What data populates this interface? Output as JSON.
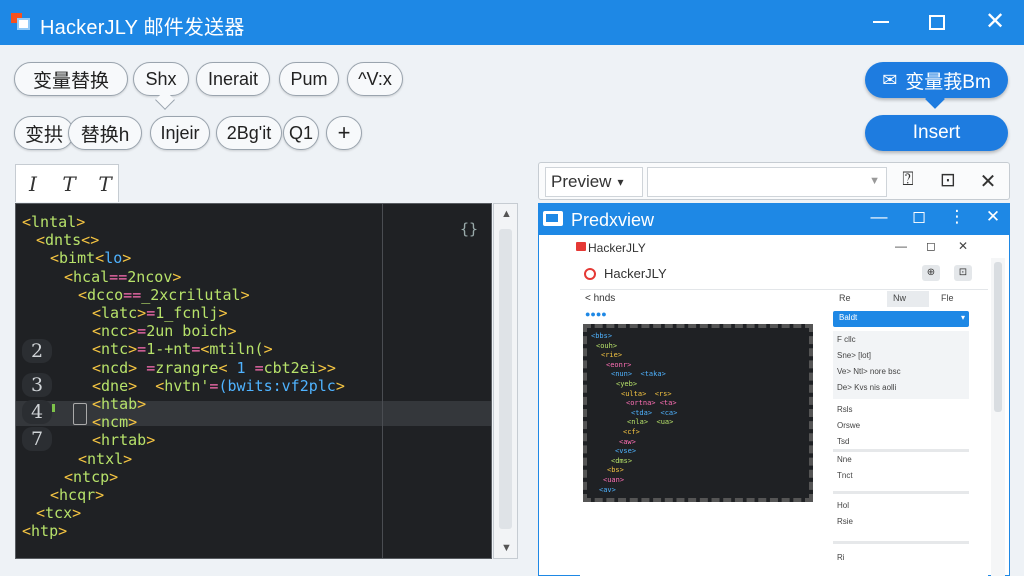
{
  "window": {
    "title": "HackerJLY 邮件发送器",
    "controls": {
      "minimize": "",
      "maximize": "",
      "close": "✕"
    }
  },
  "toolbar": {
    "row1": [
      "变量替换",
      "Shx",
      "Inerait",
      "Pum",
      "^V:x"
    ],
    "row2": [
      "变拱",
      "替换h",
      "Injeir",
      "2Bg'it",
      "Q1",
      "+"
    ],
    "send_label": "变量莪Bm",
    "insert_label": "Insert"
  },
  "editor": {
    "format_buttons": [
      "I",
      "T",
      "T"
    ],
    "fold_marker": "{}",
    "gutter_numbers": [
      "2",
      "3",
      "4",
      "7"
    ],
    "lines": [
      {
        "indent": 0,
        "text": "<lntal>"
      },
      {
        "indent": 1,
        "text": "<dnts<>"
      },
      {
        "indent": 2,
        "text": "<bimt<lo>"
      },
      {
        "indent": 3,
        "text": "<hcal==2ncov>"
      },
      {
        "indent": 4,
        "text": "<dcco==_2xcrilutal>"
      },
      {
        "indent": 5,
        "text": "<latc>=1_fcnlj>"
      },
      {
        "indent": 5,
        "text": "<ncc>=2un boich>"
      },
      {
        "indent": 5,
        "text": "<ntc>=1-+nt=<mtiln(>"
      },
      {
        "indent": 5,
        "text": "<ncd> =zrangre< 1 =cbt2ei>>"
      },
      {
        "indent": 5,
        "text": "<dne>  <hvtn'=(bwits:vf2plc>"
      },
      {
        "indent": 5,
        "text": "<htab>"
      },
      {
        "indent": 5,
        "text": "<ncm>"
      },
      {
        "indent": 5,
        "text": "<hrtab>"
      },
      {
        "indent": 4,
        "text": "<ntxl>"
      },
      {
        "indent": 3,
        "text": "<ntcp>"
      },
      {
        "indent": 2,
        "text": "<hcqr>"
      },
      {
        "indent": 1,
        "text": "<tcx>"
      },
      {
        "indent": 0,
        "text": "<htp>"
      }
    ]
  },
  "preview": {
    "dropdown_label": "Preview",
    "window_title": "Predxview",
    "mini": {
      "title": "HackerJLY",
      "subtitle": "HackerJLY",
      "crumb": "< hnds",
      "dots": "●●●●",
      "tabs": [
        "Re",
        "Nw",
        "Fle"
      ],
      "selected": "Baldt",
      "panel_rows": [
        "F cllc",
        "Sne> [lot]",
        "Ve> Ntl> nore bsc",
        "De> Kvs nis aolli"
      ],
      "list_rows": [
        "Rsls",
        "Orswe",
        "Tsd",
        "Nne",
        "Tnct",
        "Hol",
        "Rsie",
        "Ri"
      ],
      "editor_lines": [
        "<bbs>",
        "<ouh>",
        "<rie>",
        "<eonr>",
        "<nun>  <taka>",
        "<yeb>",
        "<ulta>  <rs>",
        "<ortna> <ta>",
        "<tda>  <ca>",
        "<nla>  <ua>",
        "<cf>",
        "<aw>",
        "<vse>",
        "<dms>",
        "<bs>",
        "<uan>",
        "<av>"
      ]
    }
  },
  "colors": {
    "titlebar": "#1e88e5",
    "accent_button": "#1e7ce0",
    "editor_bg": "#1f2124",
    "tag": "#f5c542",
    "attr": "#4fb3ff",
    "value": "#ff6fb5",
    "text": "#b7e26a"
  }
}
